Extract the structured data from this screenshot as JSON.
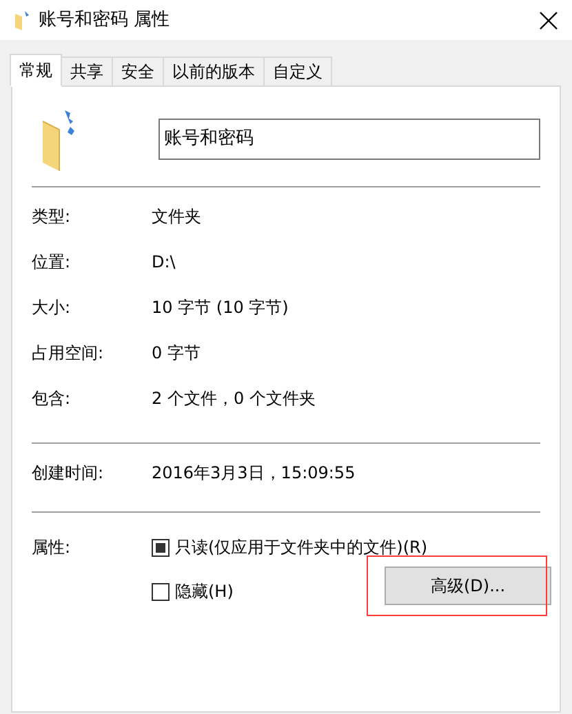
{
  "window": {
    "title": "账号和密码 属性"
  },
  "tabs": [
    {
      "label": "常规",
      "selected": true
    },
    {
      "label": "共享",
      "selected": false
    },
    {
      "label": "安全",
      "selected": false
    },
    {
      "label": "以前的版本",
      "selected": false
    },
    {
      "label": "自定义",
      "selected": false
    }
  ],
  "name_field": {
    "value": "账号和密码"
  },
  "info_groups": [
    [
      {
        "label": "类型:",
        "value": "文件夹"
      },
      {
        "label": "位置:",
        "value": "D:\\"
      },
      {
        "label": "大小:",
        "value": "10 字节 (10 字节)"
      },
      {
        "label": "占用空间:",
        "value": "0 字节"
      },
      {
        "label": "包含:",
        "value": "2 个文件，0 个文件夹"
      }
    ],
    [
      {
        "label": "创建时间:",
        "value": "2016年3月3日，15:09:55"
      }
    ]
  ],
  "attributes": {
    "label": "属性:",
    "checkboxes": [
      {
        "label": "只读(仅应用于文件夹中的文件)(R)",
        "checked": true,
        "indeterminate": true
      },
      {
        "label": "隐藏(H)",
        "checked": false,
        "indeterminate": false
      }
    ],
    "advanced_button": {
      "label": "高级(D)...",
      "highlighted": true
    }
  }
}
